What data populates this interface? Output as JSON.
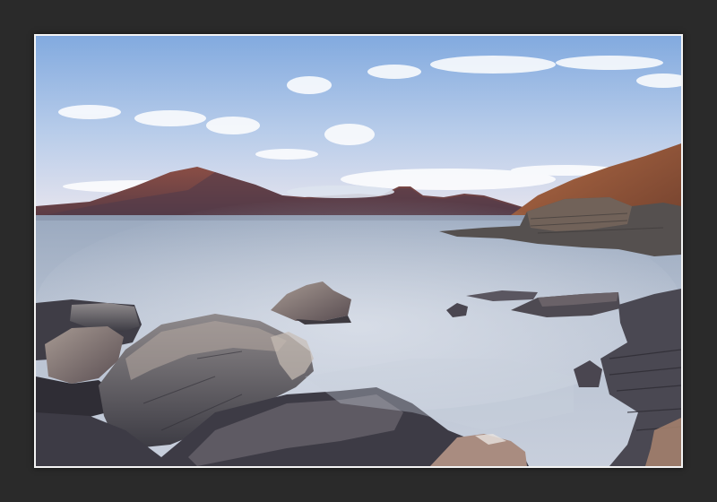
{
  "page": {
    "background": "#2a2a2a",
    "frame_color": "#f4f4f4"
  },
  "photo": {
    "subject": "landscape-photo",
    "palette": {
      "sky_top": "#8fb3e0",
      "sky_horizon": "#d9e2f0",
      "mountain": "#7a4640",
      "water": "#aeb8c9",
      "rock": "#5b5a62",
      "cliff": "#8a4a30"
    }
  }
}
